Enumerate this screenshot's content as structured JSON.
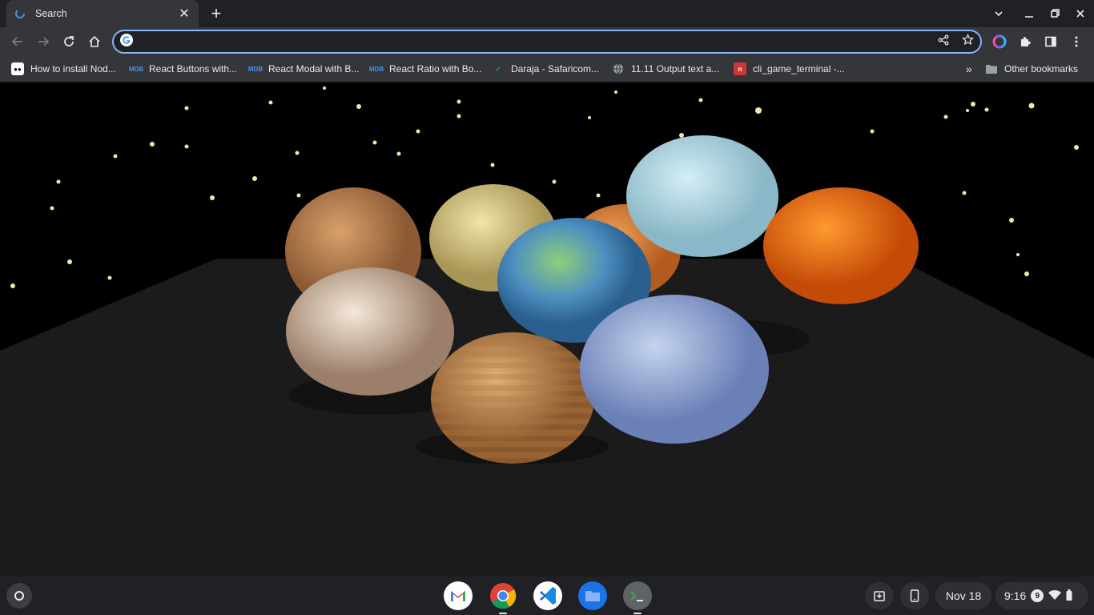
{
  "browser": {
    "tab": {
      "title": "Search",
      "close_icon": "close-icon"
    },
    "new_tab_icon": "plus-icon",
    "window_controls": [
      "chevron-down-icon",
      "minimize-icon",
      "restore-icon",
      "close-icon"
    ],
    "omnibox": {
      "value": "",
      "placeholder": ""
    },
    "bookmarks": [
      {
        "label": "How to install Nod...",
        "icon": "medium-icon"
      },
      {
        "label": "React Buttons with...",
        "icon": "mdb-icon"
      },
      {
        "label": "React Modal with B...",
        "icon": "mdb-icon"
      },
      {
        "label": "React Ratio with Bo...",
        "icon": "mdb-icon"
      },
      {
        "label": "Daraja - Safaricom...",
        "icon": "safaricom-icon"
      },
      {
        "label": "11.11 Output text a...",
        "icon": "globe-icon"
      },
      {
        "label": "cli_game_terminal -...",
        "icon": "npm-icon"
      }
    ],
    "other_bookmarks": "Other bookmarks"
  },
  "scene": {
    "description_icon": "solar-system-planets"
  },
  "shelf": {
    "apps": [
      "gmail-icon",
      "chrome-icon",
      "vscode-icon",
      "files-icon",
      "terminal-icon"
    ],
    "date": "Nov 18",
    "time": "9:16",
    "notification_count": "9"
  },
  "colors": {
    "accent": "#8ab4f8",
    "toolbar": "#35363a",
    "frame": "#202124"
  }
}
